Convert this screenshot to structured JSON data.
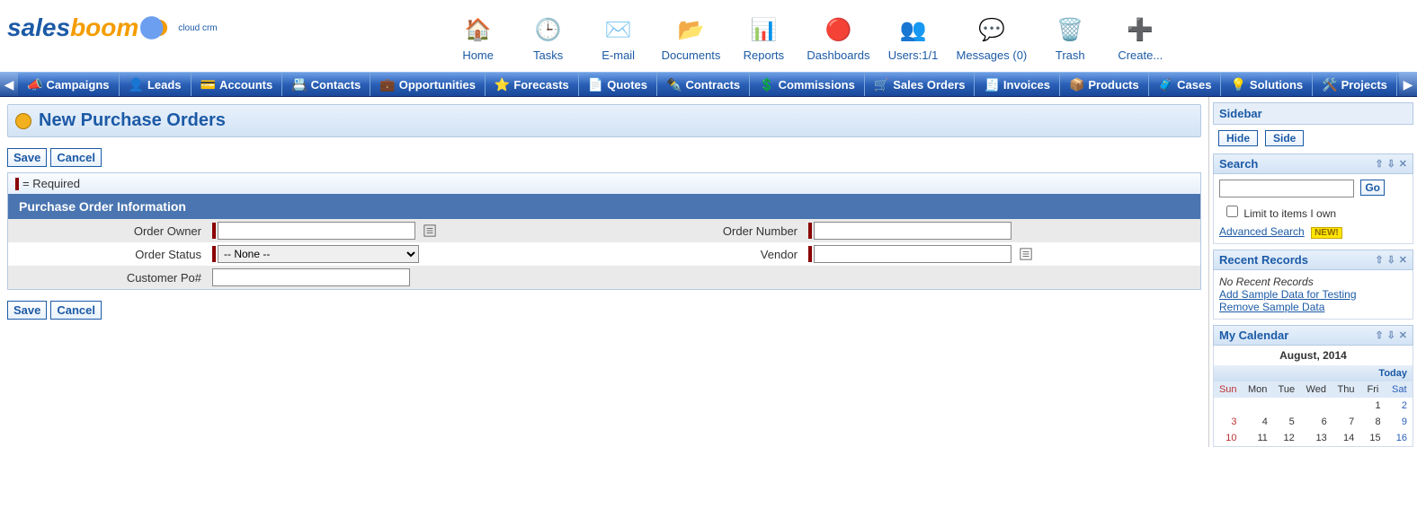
{
  "logo": {
    "sales": "sales",
    "boom": "boom",
    "sub": "cloud crm"
  },
  "toolbar": [
    {
      "label": "Home",
      "icon": "🏠"
    },
    {
      "label": "Tasks",
      "icon": "🕒"
    },
    {
      "label": "E-mail",
      "icon": "✉️"
    },
    {
      "label": "Documents",
      "icon": "📂"
    },
    {
      "label": "Reports",
      "icon": "📊"
    },
    {
      "label": "Dashboards",
      "icon": "🔴"
    },
    {
      "label": "Users:1/1",
      "icon": "👥"
    },
    {
      "label": "Messages (0)",
      "icon": "💬"
    },
    {
      "label": "Trash",
      "icon": "🗑️"
    },
    {
      "label": "Create...",
      "icon": "➕"
    }
  ],
  "nav": [
    {
      "label": "Campaigns",
      "icon": "📣"
    },
    {
      "label": "Leads",
      "icon": "👤"
    },
    {
      "label": "Accounts",
      "icon": "💳"
    },
    {
      "label": "Contacts",
      "icon": "📇"
    },
    {
      "label": "Opportunities",
      "icon": "💼"
    },
    {
      "label": "Forecasts",
      "icon": "⭐"
    },
    {
      "label": "Quotes",
      "icon": "📄"
    },
    {
      "label": "Contracts",
      "icon": "✒️"
    },
    {
      "label": "Commissions",
      "icon": "💲"
    },
    {
      "label": "Sales Orders",
      "icon": "🛒"
    },
    {
      "label": "Invoices",
      "icon": "🧾"
    },
    {
      "label": "Products",
      "icon": "📦"
    },
    {
      "label": "Cases",
      "icon": "🧳"
    },
    {
      "label": "Solutions",
      "icon": "💡"
    },
    {
      "label": "Projects",
      "icon": "🛠️"
    }
  ],
  "page": {
    "title": "New Purchase Orders"
  },
  "buttons": {
    "save": "Save",
    "cancel": "Cancel"
  },
  "form": {
    "required_note": "= Required",
    "section": "Purchase Order Information",
    "order_owner_label": "Order Owner",
    "order_owner_value": "",
    "order_number_label": "Order Number",
    "order_number_value": "",
    "order_status_label": "Order Status",
    "order_status_value": "-- None --",
    "vendor_label": "Vendor",
    "vendor_value": "",
    "customer_po_label": "Customer Po#",
    "customer_po_value": ""
  },
  "sidebar": {
    "title": "Sidebar",
    "hide": "Hide",
    "side": "Side",
    "search": {
      "title": "Search",
      "go": "Go",
      "limit": "Limit to items I own",
      "advanced": "Advanced Search",
      "new": "NEW!"
    },
    "recent": {
      "title": "Recent Records",
      "empty": "No Recent Records",
      "add": "Add Sample Data for Testing",
      "remove": "Remove Sample Data"
    },
    "calendar": {
      "title": "My Calendar",
      "month": "August, 2014",
      "today": "Today",
      "days": [
        "Sun",
        "Mon",
        "Tue",
        "Wed",
        "Thu",
        "Fri",
        "Sat"
      ],
      "rows": [
        [
          "",
          "",
          "",
          "",
          "",
          "1",
          "2"
        ],
        [
          "3",
          "4",
          "5",
          "6",
          "7",
          "8",
          "9"
        ],
        [
          "10",
          "11",
          "12",
          "13",
          "14",
          "15",
          "16"
        ]
      ]
    }
  }
}
